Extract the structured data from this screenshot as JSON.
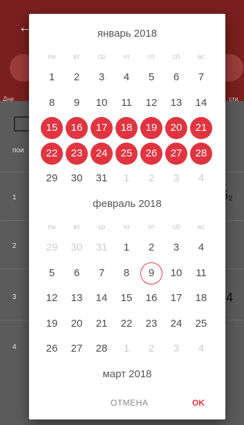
{
  "background": {
    "tab_left": "Дне",
    "tab_right": "сти",
    "table_header": "пои",
    "row_numbers": [
      "1",
      "2",
      "3",
      "4"
    ],
    "right_values": [
      "5₂",
      "4"
    ]
  },
  "weekdays": [
    "пн",
    "вт",
    "ср",
    "чт",
    "пт",
    "сб",
    "вс"
  ],
  "months": [
    {
      "title": "январь 2018",
      "weeks": [
        [
          {
            "d": "1"
          },
          {
            "d": "2"
          },
          {
            "d": "3"
          },
          {
            "d": "4"
          },
          {
            "d": "5"
          },
          {
            "d": "6"
          },
          {
            "d": "7"
          }
        ],
        [
          {
            "d": "8"
          },
          {
            "d": "9"
          },
          {
            "d": "10"
          },
          {
            "d": "11"
          },
          {
            "d": "12"
          },
          {
            "d": "13"
          },
          {
            "d": "14"
          }
        ],
        [
          {
            "d": "15",
            "s": "sel"
          },
          {
            "d": "16",
            "s": "sel"
          },
          {
            "d": "17",
            "s": "sel"
          },
          {
            "d": "18",
            "s": "sel"
          },
          {
            "d": "19",
            "s": "sel"
          },
          {
            "d": "20",
            "s": "sel"
          },
          {
            "d": "21",
            "s": "sel"
          }
        ],
        [
          {
            "d": "22",
            "s": "sel"
          },
          {
            "d": "23",
            "s": "sel"
          },
          {
            "d": "24",
            "s": "sel"
          },
          {
            "d": "25",
            "s": "sel"
          },
          {
            "d": "26",
            "s": "sel"
          },
          {
            "d": "27",
            "s": "sel"
          },
          {
            "d": "28",
            "s": "sel"
          }
        ],
        [
          {
            "d": "29"
          },
          {
            "d": "30"
          },
          {
            "d": "31"
          },
          {
            "d": "1",
            "s": "other"
          },
          {
            "d": "2",
            "s": "other"
          },
          {
            "d": "3",
            "s": "other"
          },
          {
            "d": "4",
            "s": "other"
          }
        ]
      ]
    },
    {
      "title": "февраль 2018",
      "weeks": [
        [
          {
            "d": "29",
            "s": "other"
          },
          {
            "d": "30",
            "s": "other"
          },
          {
            "d": "31",
            "s": "other"
          },
          {
            "d": "1"
          },
          {
            "d": "2"
          },
          {
            "d": "3"
          },
          {
            "d": "4"
          }
        ],
        [
          {
            "d": "5"
          },
          {
            "d": "6"
          },
          {
            "d": "7"
          },
          {
            "d": "8"
          },
          {
            "d": "9",
            "s": "today"
          },
          {
            "d": "10"
          },
          {
            "d": "11"
          }
        ],
        [
          {
            "d": "12"
          },
          {
            "d": "13"
          },
          {
            "d": "14"
          },
          {
            "d": "15"
          },
          {
            "d": "16"
          },
          {
            "d": "17"
          },
          {
            "d": "18"
          }
        ],
        [
          {
            "d": "19"
          },
          {
            "d": "20"
          },
          {
            "d": "21"
          },
          {
            "d": "22"
          },
          {
            "d": "23"
          },
          {
            "d": "24"
          },
          {
            "d": "25"
          }
        ],
        [
          {
            "d": "26"
          },
          {
            "d": "27"
          },
          {
            "d": "28"
          },
          {
            "d": "1",
            "s": "other"
          },
          {
            "d": "2",
            "s": "other"
          },
          {
            "d": "3",
            "s": "other"
          },
          {
            "d": "4",
            "s": "other"
          }
        ]
      ]
    },
    {
      "title": "март 2018",
      "weeks": []
    }
  ],
  "buttons": {
    "cancel": "ОТМЕНА",
    "ok": "OK"
  },
  "colors": {
    "accent": "#e03540",
    "dialog_bg": "#ffffff"
  }
}
